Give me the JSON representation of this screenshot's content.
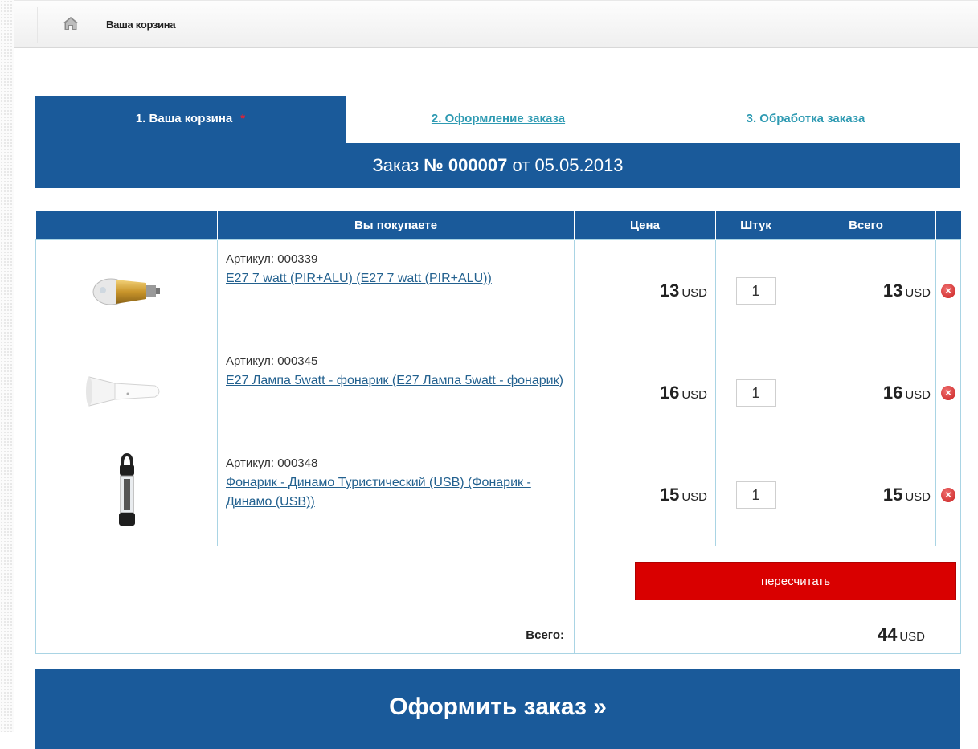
{
  "breadcrumb": {
    "home_icon": "home-icon",
    "label": "Ваша корзина"
  },
  "tabs": [
    {
      "label": "1. Ваша корзина",
      "marker": "*"
    },
    {
      "label": "2. Оформление заказа"
    },
    {
      "label": "3. Обработка заказа"
    }
  ],
  "order": {
    "prefix": "Заказ",
    "number": "№ 000007",
    "date_prefix": "от",
    "date": "05.05.2013"
  },
  "table": {
    "headers": [
      "",
      "Вы покупаете",
      "Цена",
      "Штук",
      "Всего",
      ""
    ],
    "items": [
      {
        "sku": "Артикул: 000339",
        "name": "E27 7 watt (PIR+ALU) (E27 7 watt (PIR+ALU))",
        "price": "13",
        "currency": "USD",
        "qty": "1",
        "total": "13",
        "image": "gold-bulb-image"
      },
      {
        "sku": "Артикул: 000345",
        "name": "E27 Лампа 5watt - фонарик (E27 Лампа 5watt - фонарик)",
        "price": "16",
        "currency": "USD",
        "qty": "1",
        "total": "16",
        "image": "white-flashlight-image"
      },
      {
        "sku": "Артикул: 000348",
        "name": "Фонарик - Динамо Туристический (USB) (Фонарик - Динамо (USB))",
        "price": "15",
        "currency": "USD",
        "qty": "1",
        "total": "15",
        "image": "dynamo-lantern-image"
      }
    ],
    "recalc_label": "пересчитать",
    "sum_label": "Всего:",
    "sum_value": "44",
    "sum_currency": "USD"
  },
  "checkout_label": "Оформить заказ »",
  "colors": {
    "primary": "#1a5a9a",
    "link": "#2e9ab2",
    "danger": "#d90000",
    "table_border": "#a9d4e4"
  }
}
